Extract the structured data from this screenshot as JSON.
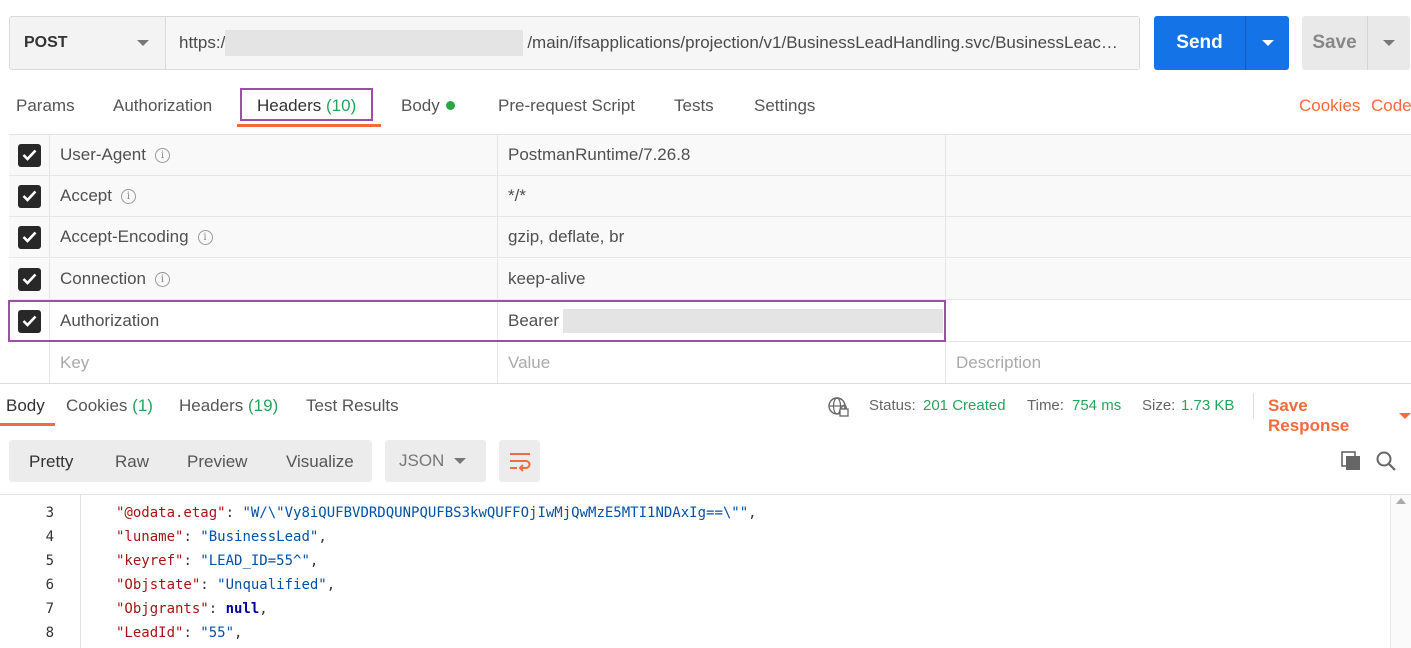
{
  "request": {
    "method": "POST",
    "url_prefix": "https:/",
    "url_suffix": "/main/ifsapplications/projection/v1/BusinessLeadHandling.svc/BusinessLeac…",
    "send_label": "Send",
    "save_label": "Save"
  },
  "request_tabs": [
    {
      "label": "Params"
    },
    {
      "label": "Authorization"
    },
    {
      "label": "Headers",
      "count": "(10)"
    },
    {
      "label": "Body"
    },
    {
      "label": "Pre-request Script"
    },
    {
      "label": "Tests"
    },
    {
      "label": "Settings"
    }
  ],
  "links": {
    "cookies": "Cookies",
    "code": "Code"
  },
  "headers": [
    {
      "key": "User-Agent",
      "value": "PostmanRuntime/7.26.8"
    },
    {
      "key": "Accept",
      "value": "*/*"
    },
    {
      "key": "Accept-Encoding",
      "value": "gzip, deflate, br"
    },
    {
      "key": "Connection",
      "value": "keep-alive"
    },
    {
      "key": "Authorization",
      "value": "Bearer"
    }
  ],
  "new_row": {
    "key": "Key",
    "value": "Value",
    "description": "Description"
  },
  "response_tabs": [
    {
      "label": "Body"
    },
    {
      "label": "Cookies",
      "count": "(1)"
    },
    {
      "label": "Headers",
      "count": "(19)"
    },
    {
      "label": "Test Results"
    }
  ],
  "status": {
    "status_label": "Status:",
    "status_value": "201 Created",
    "time_label": "Time:",
    "time_value": "754 ms",
    "size_label": "Size:",
    "size_value": "1.73 KB",
    "save_response": "Save Response"
  },
  "view_modes": [
    "Pretty",
    "Raw",
    "Preview",
    "Visualize"
  ],
  "format": "JSON",
  "code_lines": [
    {
      "no": "3",
      "key": "\"@odata.etag\"",
      "value": "\"W/\\\"Vy8iQUFBVDRDQUNPQUFBS3kwQUFFOjIwMjQwMzE5MTI1NDAxIg==\\\"\"",
      "kind": "string"
    },
    {
      "no": "4",
      "key": "\"luname\"",
      "value": "\"BusinessLead\"",
      "kind": "string"
    },
    {
      "no": "5",
      "key": "\"keyref\"",
      "value": "\"LEAD_ID=55^\"",
      "kind": "string"
    },
    {
      "no": "6",
      "key": "\"Objstate\"",
      "value": "\"Unqualified\"",
      "kind": "string"
    },
    {
      "no": "7",
      "key": "\"Objgrants\"",
      "value": "null",
      "kind": "null"
    },
    {
      "no": "8",
      "key": "\"LeadId\"",
      "value": "\"55\"",
      "kind": "string"
    }
  ]
}
